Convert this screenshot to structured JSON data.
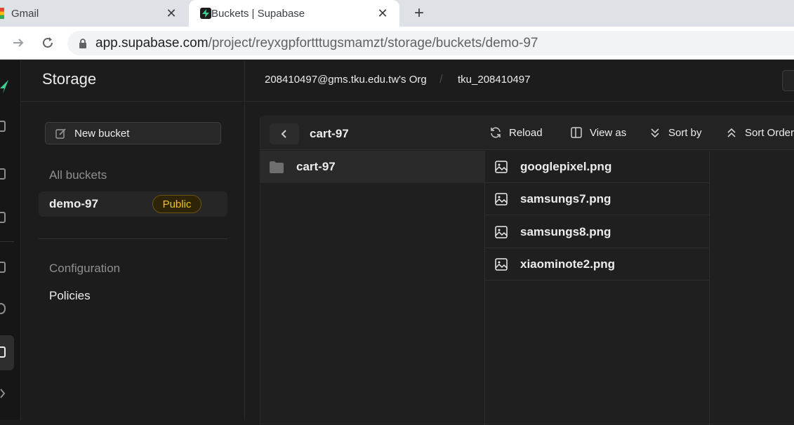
{
  "browser": {
    "tabs": [
      {
        "title": "Gmail",
        "active": false
      },
      {
        "title": "Buckets | Supabase",
        "active": true
      }
    ],
    "url_host": "app.supabase.com",
    "url_path": "/project/reyxgpfortttugsmamzt/storage/buckets/demo-97"
  },
  "sidebar": {
    "title": "Storage",
    "new_bucket_label": "New bucket",
    "all_buckets_label": "All buckets",
    "buckets": [
      {
        "name": "demo-97",
        "badge": "Public"
      }
    ],
    "configuration_label": "Configuration",
    "policies_label": "Policies"
  },
  "topnav": {
    "org": "208410497@gms.tku.edu.tw's Org",
    "separator": "/",
    "project": "tku_208410497"
  },
  "explorer": {
    "current_folder": "cart-97",
    "tools": {
      "reload": "Reload",
      "view_as": "View as",
      "sort_by": "Sort by",
      "sort_order": "Sort Order"
    },
    "folders": [
      {
        "name": "cart-97"
      }
    ],
    "files": [
      {
        "name": "googlepixel.png"
      },
      {
        "name": "samsungs7.png"
      },
      {
        "name": "samsungs8.png"
      },
      {
        "name": "xiaominote2.png"
      }
    ]
  },
  "colors": {
    "brand": "#3ecf8e",
    "badge": "#f1c21b"
  }
}
